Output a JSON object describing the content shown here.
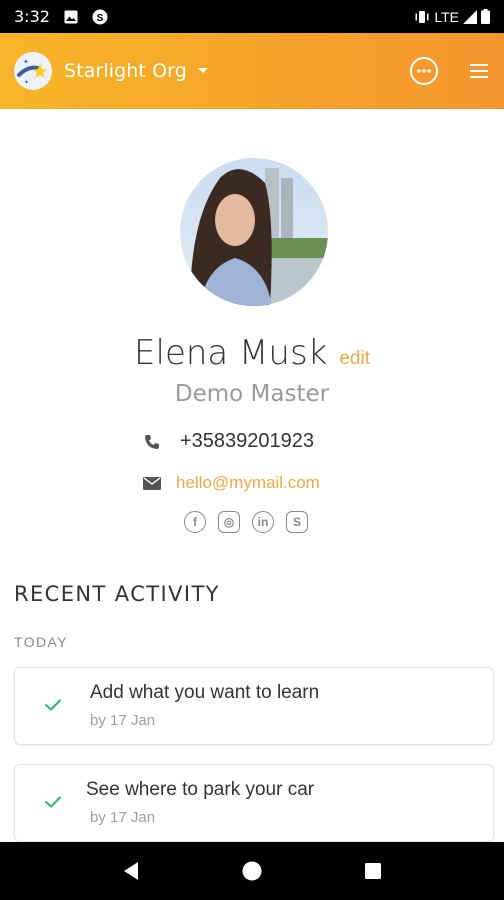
{
  "status_bar": {
    "time": "3:32",
    "network": "LTE",
    "icons": [
      "image-icon",
      "vpn-icon",
      "vibrate-icon",
      "signal-icon",
      "battery-icon"
    ]
  },
  "app_bar": {
    "org_name": "Starlight Org",
    "icons": [
      "org-logo-icon",
      "chevron-down-icon",
      "more-icon",
      "menu-icon"
    ],
    "background_colors": [
      "#f6b528",
      "#f4952c"
    ]
  },
  "profile": {
    "name": "Elena Musk",
    "edit_label": "edit",
    "role": "Demo Master",
    "phone": "+35839201923",
    "email": "hello@mymail.com",
    "socials": [
      {
        "icon": "facebook-icon",
        "glyph": "f"
      },
      {
        "icon": "instagram-icon",
        "glyph": "◎"
      },
      {
        "icon": "linkedin-icon",
        "glyph": "in"
      },
      {
        "icon": "skype-icon",
        "glyph": "S"
      }
    ]
  },
  "activity": {
    "title": "RECENT ACTIVITY",
    "day_label": "TODAY",
    "items": [
      {
        "title": "Add what you want to learn",
        "subtitle": "by 17 Jan",
        "icon": "check-icon"
      },
      {
        "title": "See where to park your car",
        "subtitle": "by 17 Jan",
        "icon": "check-icon"
      }
    ]
  },
  "nav_bar": {
    "icons": [
      "back-icon",
      "home-icon",
      "recents-icon"
    ]
  },
  "colors": {
    "accent": "#f6a544",
    "check": "#2eb86c"
  }
}
